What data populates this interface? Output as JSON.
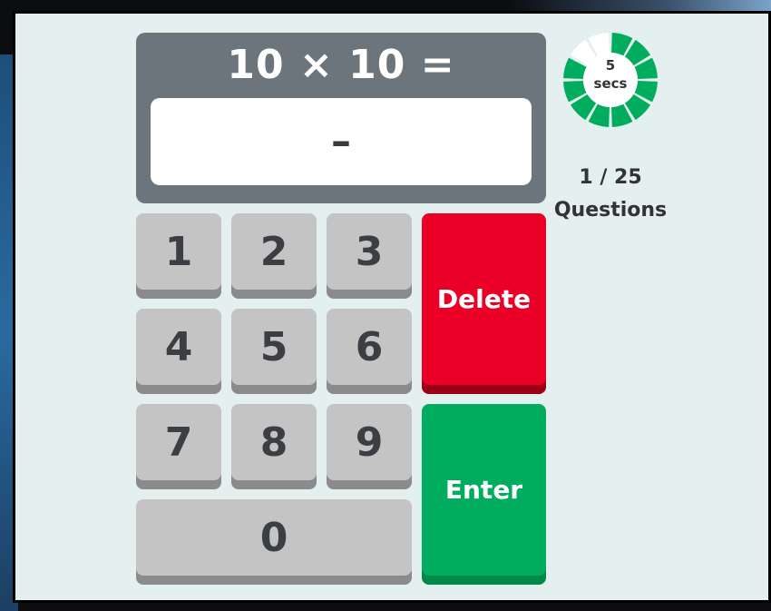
{
  "question": {
    "text": "10 × 10 ="
  },
  "answer": {
    "value": "–"
  },
  "keypad": {
    "keys": [
      "1",
      "2",
      "3",
      "4",
      "5",
      "6",
      "7",
      "8",
      "9",
      "0"
    ],
    "delete_label": "Delete",
    "enter_label": "Enter"
  },
  "timer": {
    "seconds": "5",
    "unit": "secs",
    "segments_total": 12,
    "segments_remaining": 10,
    "color_active": "#00ad5e",
    "color_inactive": "#ffffff"
  },
  "progress": {
    "current_of_total": "1 / 25",
    "label": "Questions"
  },
  "colors": {
    "display_bg": "#6b757b",
    "panel_bg": "#e3f0ef",
    "key_bg": "#c4c4c4",
    "delete_bg": "#ea0027",
    "enter_bg": "#00ad5e"
  }
}
